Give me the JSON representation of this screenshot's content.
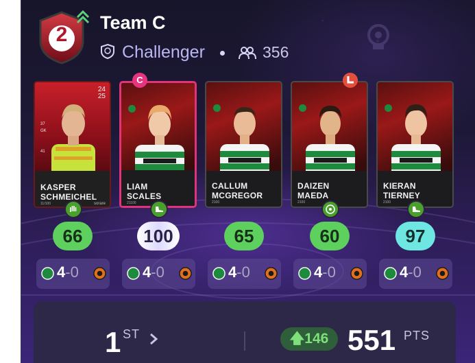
{
  "header": {
    "rank": "2",
    "team_name": "Team C",
    "league": "Challenger",
    "separator": "•",
    "members": "356"
  },
  "cards": [
    {
      "first": "KASPER",
      "last": "SCHMEICHEL",
      "meta": "11/100",
      "badge": "",
      "score": "66",
      "pill": "green",
      "selected": false
    },
    {
      "first": "LIAM",
      "last": "SCALES",
      "meta": "21100",
      "badge": "C",
      "score": "100",
      "pill": "white",
      "selected": true
    },
    {
      "first": "CALLUM",
      "last": "MCGREGOR",
      "meta": "2100",
      "badge": "",
      "score": "65",
      "pill": "green",
      "selected": false
    },
    {
      "first": "DAIZEN",
      "last": "MAEDA",
      "meta": "2100",
      "badge": "arrow",
      "score": "60",
      "pill": "green",
      "selected": false
    },
    {
      "first": "KIERAN",
      "last": "TIERNEY",
      "meta": "2100",
      "badge": "",
      "score": "97",
      "pill": "cyan",
      "selected": false
    }
  ],
  "gk_card": {
    "season_top": "24",
    "season_bottom": "25",
    "stats": [
      "37",
      "GK",
      "41"
    ],
    "brand": "sorare"
  },
  "fixtures": [
    {
      "home_score": "4",
      "dash": "-",
      "away_score": "0"
    },
    {
      "home_score": "4",
      "dash": "-",
      "away_score": "0"
    },
    {
      "home_score": "4",
      "dash": "-",
      "away_score": "0"
    },
    {
      "home_score": "4",
      "dash": "-",
      "away_score": "0"
    },
    {
      "home_score": "4",
      "dash": "-",
      "away_score": "0"
    }
  ],
  "bottom": {
    "position": "1",
    "position_suffix": "ST",
    "rise": "146",
    "points": "551",
    "points_label": "PTS"
  },
  "colors": {
    "captain_badge": "#e6357f",
    "score_green": "#5ed05e",
    "score_cyan": "#6ee6e2",
    "rank_red": "#b0162a",
    "league_text": "#b9b6f2"
  },
  "icons": {
    "rank": "shield-rank-icon",
    "rank_change": "double-chevron-up-icon",
    "league": "league-badge-icon",
    "members": "people-icon",
    "boost": "boot-icon"
  }
}
